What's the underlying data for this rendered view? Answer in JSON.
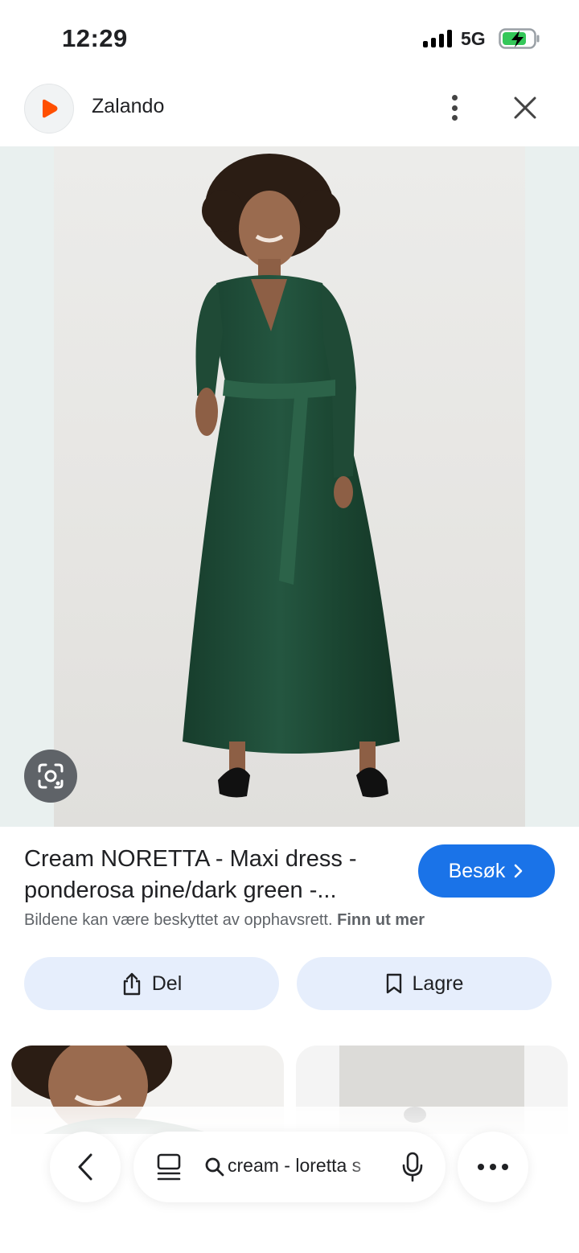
{
  "status_bar": {
    "time": "12:29",
    "network": "5G",
    "signal_bars": 4,
    "battery_charging": true
  },
  "header": {
    "site_name": "Zalando",
    "logo_icon": "zalando-play-logo-icon",
    "menu_icon": "more-vertical-icon",
    "close_icon": "close-icon"
  },
  "main_image": {
    "lens_icon": "google-lens-icon"
  },
  "result": {
    "title_line1": "Cream NORETTA - Maxi dress -",
    "title_line2": "ponderosa pine/dark green -...",
    "visit_label": "Besøk",
    "copyright_text": "Bildene kan være beskyttet av opphavsrett.",
    "learn_more": "Finn ut mer"
  },
  "actions": {
    "share_label": "Del",
    "save_label": "Lagre"
  },
  "bottom_nav": {
    "query": "cream - loretta s",
    "back_icon": "chevron-left-icon",
    "tabs_icon": "tabs-icon",
    "search_icon": "search-icon",
    "mic_icon": "mic-icon",
    "overflow_icon": "more-horizontal-icon"
  },
  "colors": {
    "accent": "#1a73e8",
    "tonal_button": "#e6eefc",
    "dress": "#1f4a36",
    "logo": "#ff4f00"
  }
}
